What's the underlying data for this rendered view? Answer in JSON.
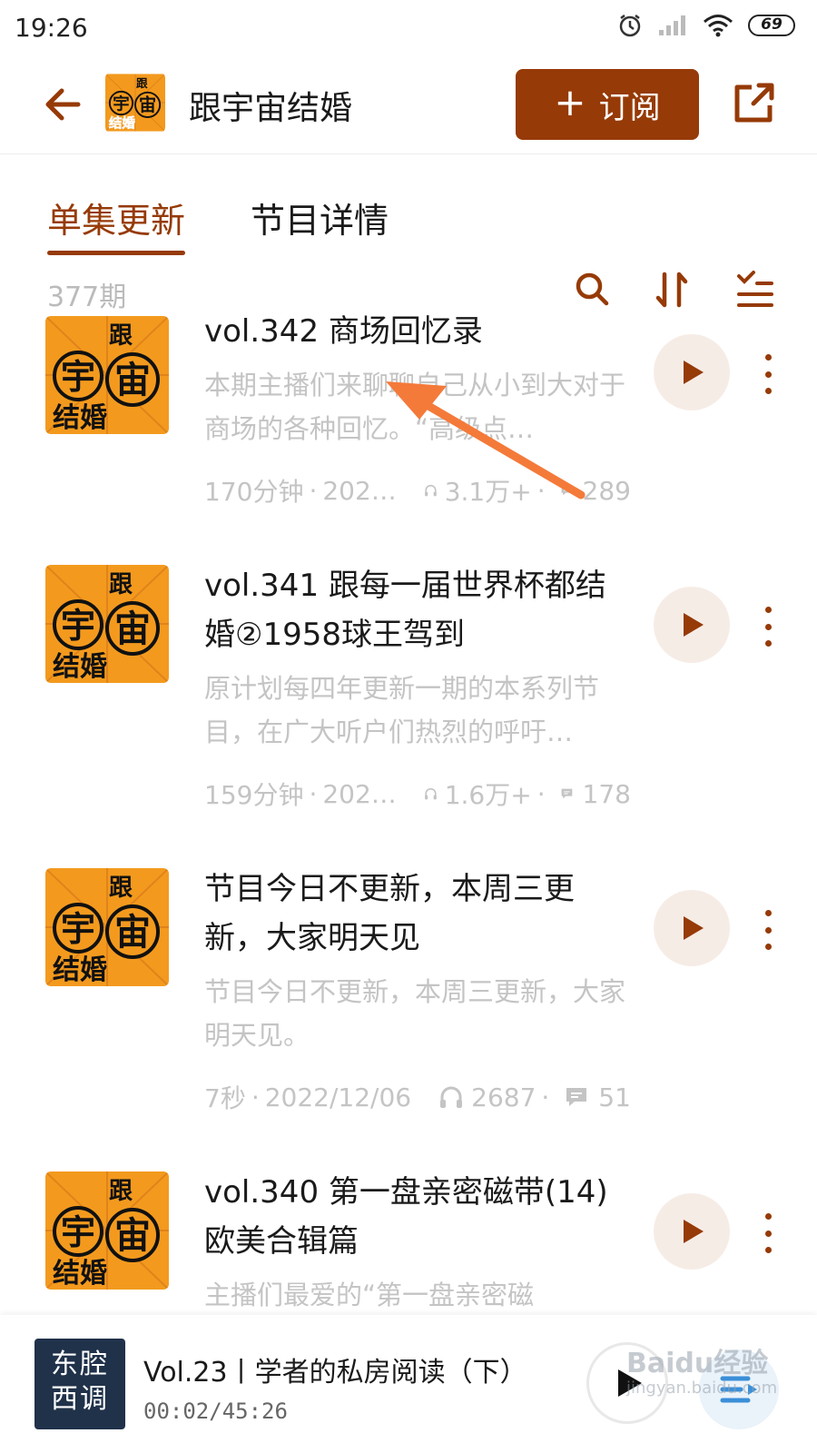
{
  "status_bar": {
    "time": "19:26",
    "battery": "69"
  },
  "header": {
    "title": "跟宇宙结婚",
    "subscribe_label": "订阅"
  },
  "tabs": [
    {
      "label": "单集更新"
    },
    {
      "label": "节目详情"
    }
  ],
  "list": {
    "count": "377期"
  },
  "cover_art": {
    "line1": "跟",
    "line2_left": "宇",
    "line2_right": "宙",
    "line3": "结婚"
  },
  "episodes": [
    {
      "title": "vol.342 商场回忆录",
      "desc": "本期主播们来聊聊自己从小到大对于商场的各种回忆。“高级点…",
      "duration": "170分钟",
      "date": "202…",
      "plays": "3.1万+",
      "comments": "289"
    },
    {
      "title": "vol.341 跟每一届世界杯都结婚②1958球王驾到",
      "desc": "原计划每四年更新一期的本系列节目，在广大听户们热烈的呼吁…",
      "duration": "159分钟",
      "date": "202…",
      "plays": "1.6万+",
      "comments": "178"
    },
    {
      "title": "节目今日不更新，本周三更新，大家明天见",
      "desc": "节目今日不更新，本周三更新，大家明天见。",
      "duration": "7秒",
      "date": "2022/12/06",
      "plays": "2687",
      "comments": "51"
    },
    {
      "title": "vol.340 第一盘亲密磁带(14)欧美合辑篇",
      "desc": "主播们最爱的“第一盘亲密磁",
      "duration": "",
      "date": "",
      "plays": "",
      "comments": ""
    }
  ],
  "player": {
    "cover_text_1": "东腔",
    "cover_text_2": "西调",
    "title": "Vol.23丨学者的私房阅读（下）",
    "time": "00:02/45:26"
  },
  "watermark": {
    "text": "Baidu经验",
    "sub": "jingyan.baidu.com"
  },
  "colors": {
    "accent": "#963a07",
    "cover_orange": "#f39a1e",
    "annotation_arrow": "#f47a3a"
  }
}
